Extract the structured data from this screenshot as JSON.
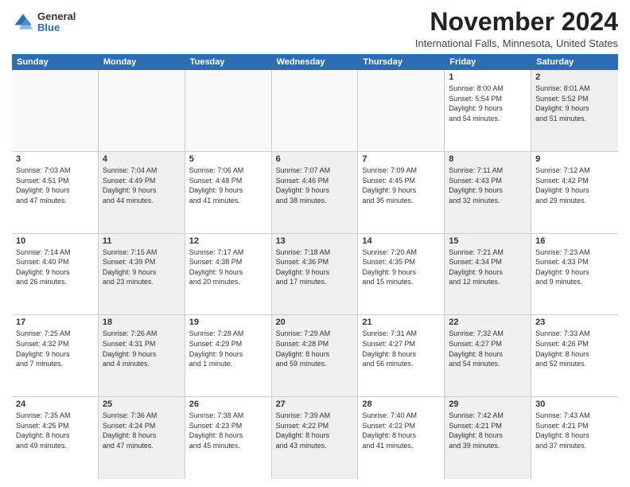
{
  "header": {
    "logo_general": "General",
    "logo_blue": "Blue",
    "month_title": "November 2024",
    "location": "International Falls, Minnesota, United States"
  },
  "weekdays": [
    "Sunday",
    "Monday",
    "Tuesday",
    "Wednesday",
    "Thursday",
    "Friday",
    "Saturday"
  ],
  "rows": [
    [
      {
        "day": "",
        "detail": "",
        "shaded": false,
        "empty": true
      },
      {
        "day": "",
        "detail": "",
        "shaded": false,
        "empty": true
      },
      {
        "day": "",
        "detail": "",
        "shaded": false,
        "empty": true
      },
      {
        "day": "",
        "detail": "",
        "shaded": false,
        "empty": true
      },
      {
        "day": "",
        "detail": "",
        "shaded": false,
        "empty": true
      },
      {
        "day": "1",
        "detail": "Sunrise: 8:00 AM\nSunset: 5:54 PM\nDaylight: 9 hours\nand 54 minutes.",
        "shaded": false,
        "empty": false
      },
      {
        "day": "2",
        "detail": "Sunrise: 8:01 AM\nSunset: 5:52 PM\nDaylight: 9 hours\nand 51 minutes.",
        "shaded": true,
        "empty": false
      }
    ],
    [
      {
        "day": "3",
        "detail": "Sunrise: 7:03 AM\nSunset: 4:51 PM\nDaylight: 9 hours\nand 47 minutes.",
        "shaded": false,
        "empty": false
      },
      {
        "day": "4",
        "detail": "Sunrise: 7:04 AM\nSunset: 4:49 PM\nDaylight: 9 hours\nand 44 minutes.",
        "shaded": true,
        "empty": false
      },
      {
        "day": "5",
        "detail": "Sunrise: 7:06 AM\nSunset: 4:48 PM\nDaylight: 9 hours\nand 41 minutes.",
        "shaded": false,
        "empty": false
      },
      {
        "day": "6",
        "detail": "Sunrise: 7:07 AM\nSunset: 4:46 PM\nDaylight: 9 hours\nand 38 minutes.",
        "shaded": true,
        "empty": false
      },
      {
        "day": "7",
        "detail": "Sunrise: 7:09 AM\nSunset: 4:45 PM\nDaylight: 9 hours\nand 35 minutes.",
        "shaded": false,
        "empty": false
      },
      {
        "day": "8",
        "detail": "Sunrise: 7:11 AM\nSunset: 4:43 PM\nDaylight: 9 hours\nand 32 minutes.",
        "shaded": true,
        "empty": false
      },
      {
        "day": "9",
        "detail": "Sunrise: 7:12 AM\nSunset: 4:42 PM\nDaylight: 9 hours\nand 29 minutes.",
        "shaded": false,
        "empty": false
      }
    ],
    [
      {
        "day": "10",
        "detail": "Sunrise: 7:14 AM\nSunset: 4:40 PM\nDaylight: 9 hours\nand 26 minutes.",
        "shaded": false,
        "empty": false
      },
      {
        "day": "11",
        "detail": "Sunrise: 7:15 AM\nSunset: 4:39 PM\nDaylight: 9 hours\nand 23 minutes.",
        "shaded": true,
        "empty": false
      },
      {
        "day": "12",
        "detail": "Sunrise: 7:17 AM\nSunset: 4:38 PM\nDaylight: 9 hours\nand 20 minutes.",
        "shaded": false,
        "empty": false
      },
      {
        "day": "13",
        "detail": "Sunrise: 7:18 AM\nSunset: 4:36 PM\nDaylight: 9 hours\nand 17 minutes.",
        "shaded": true,
        "empty": false
      },
      {
        "day": "14",
        "detail": "Sunrise: 7:20 AM\nSunset: 4:35 PM\nDaylight: 9 hours\nand 15 minutes.",
        "shaded": false,
        "empty": false
      },
      {
        "day": "15",
        "detail": "Sunrise: 7:21 AM\nSunset: 4:34 PM\nDaylight: 9 hours\nand 12 minutes.",
        "shaded": true,
        "empty": false
      },
      {
        "day": "16",
        "detail": "Sunrise: 7:23 AM\nSunset: 4:33 PM\nDaylight: 9 hours\nand 9 minutes.",
        "shaded": false,
        "empty": false
      }
    ],
    [
      {
        "day": "17",
        "detail": "Sunrise: 7:25 AM\nSunset: 4:32 PM\nDaylight: 9 hours\nand 7 minutes.",
        "shaded": false,
        "empty": false
      },
      {
        "day": "18",
        "detail": "Sunrise: 7:26 AM\nSunset: 4:31 PM\nDaylight: 9 hours\nand 4 minutes.",
        "shaded": true,
        "empty": false
      },
      {
        "day": "19",
        "detail": "Sunrise: 7:28 AM\nSunset: 4:29 PM\nDaylight: 9 hours\nand 1 minute.",
        "shaded": false,
        "empty": false
      },
      {
        "day": "20",
        "detail": "Sunrise: 7:29 AM\nSunset: 4:28 PM\nDaylight: 8 hours\nand 59 minutes.",
        "shaded": true,
        "empty": false
      },
      {
        "day": "21",
        "detail": "Sunrise: 7:31 AM\nSunset: 4:27 PM\nDaylight: 8 hours\nand 56 minutes.",
        "shaded": false,
        "empty": false
      },
      {
        "day": "22",
        "detail": "Sunrise: 7:32 AM\nSunset: 4:27 PM\nDaylight: 8 hours\nand 54 minutes.",
        "shaded": true,
        "empty": false
      },
      {
        "day": "23",
        "detail": "Sunrise: 7:33 AM\nSunset: 4:26 PM\nDaylight: 8 hours\nand 52 minutes.",
        "shaded": false,
        "empty": false
      }
    ],
    [
      {
        "day": "24",
        "detail": "Sunrise: 7:35 AM\nSunset: 4:25 PM\nDaylight: 8 hours\nand 49 minutes.",
        "shaded": false,
        "empty": false
      },
      {
        "day": "25",
        "detail": "Sunrise: 7:36 AM\nSunset: 4:24 PM\nDaylight: 8 hours\nand 47 minutes.",
        "shaded": true,
        "empty": false
      },
      {
        "day": "26",
        "detail": "Sunrise: 7:38 AM\nSunset: 4:23 PM\nDaylight: 8 hours\nand 45 minutes.",
        "shaded": false,
        "empty": false
      },
      {
        "day": "27",
        "detail": "Sunrise: 7:39 AM\nSunset: 4:22 PM\nDaylight: 8 hours\nand 43 minutes.",
        "shaded": true,
        "empty": false
      },
      {
        "day": "28",
        "detail": "Sunrise: 7:40 AM\nSunset: 4:22 PM\nDaylight: 8 hours\nand 41 minutes.",
        "shaded": false,
        "empty": false
      },
      {
        "day": "29",
        "detail": "Sunrise: 7:42 AM\nSunset: 4:21 PM\nDaylight: 8 hours\nand 39 minutes.",
        "shaded": true,
        "empty": false
      },
      {
        "day": "30",
        "detail": "Sunrise: 7:43 AM\nSunset: 4:21 PM\nDaylight: 8 hours\nand 37 minutes.",
        "shaded": false,
        "empty": false
      }
    ]
  ]
}
